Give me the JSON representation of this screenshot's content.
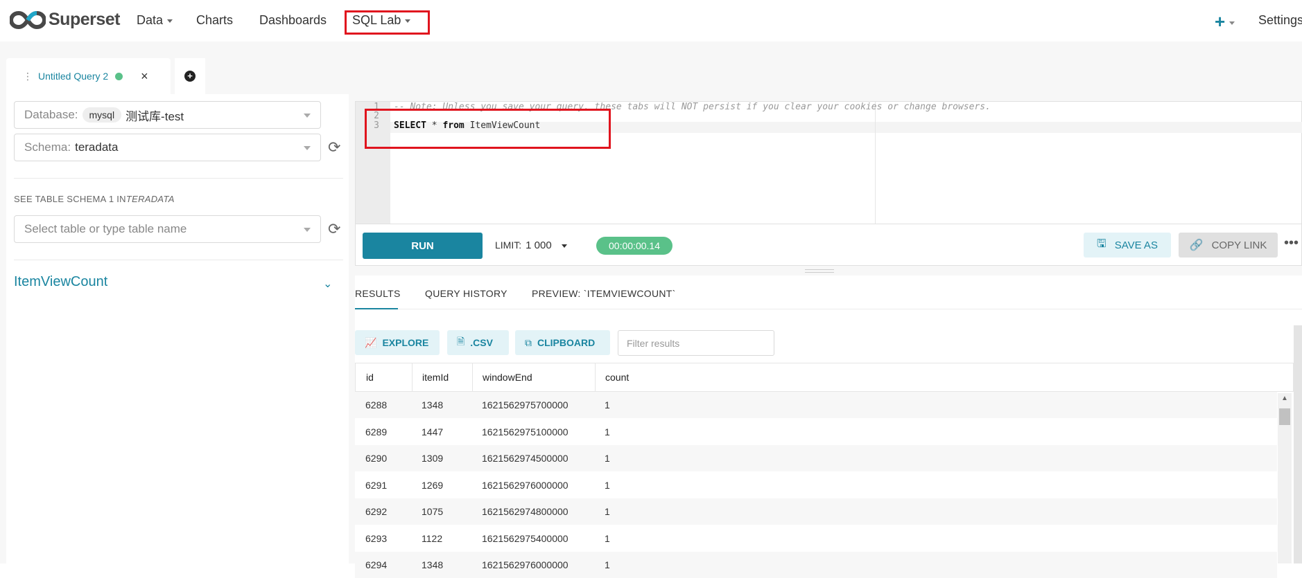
{
  "app": {
    "brand": "Superset",
    "nav": {
      "data": "Data",
      "charts": "Charts",
      "dashboards": "Dashboards",
      "sql_lab": "SQL Lab",
      "settings": "Settings",
      "plus": "+"
    },
    "accent": "#1a85a0"
  },
  "query_tab": {
    "label": "Untitled Query 2",
    "close": "×",
    "add": "+"
  },
  "left_panel": {
    "database_label": "Database:",
    "database_tag": "mysql",
    "database_value": "测试库-test",
    "schema_label": "Schema:",
    "schema_value": "teradata",
    "schema_heading": "SEE TABLE SCHEMA 1 IN",
    "schema_heading_em": "TERADATA",
    "table_select_placeholder": "Select table or type table name",
    "table_name": "ItemViewCount"
  },
  "editor": {
    "line_numbers": [
      "1",
      "2",
      "3"
    ],
    "line1": "-- Note: Unless you save your query, these tabs will NOT persist if you clear your cookies or change browsers.",
    "line3_kw1": "SELECT",
    "line3_star": " * ",
    "line3_kw2": "from",
    "line3_table": " ItemViewCount"
  },
  "controls": {
    "run": "RUN",
    "limit_label": "LIMIT:",
    "limit_value": "1 000",
    "timer": "00:00:00.14",
    "save_as": "SAVE AS",
    "copy_link": "COPY LINK",
    "more": "•••"
  },
  "results": {
    "tabs": [
      "RESULTS",
      "QUERY HISTORY",
      "PREVIEW: `ITEMVIEWCOUNT`"
    ],
    "explore": "EXPLORE",
    "csv": ".CSV",
    "clipboard": "CLIPBOARD",
    "filter_placeholder": "Filter results",
    "columns": [
      "id",
      "itemId",
      "windowEnd",
      "count"
    ],
    "rows": [
      [
        "6288",
        "1348",
        "1621562975700000",
        "1"
      ],
      [
        "6289",
        "1447",
        "1621562975100000",
        "1"
      ],
      [
        "6290",
        "1309",
        "1621562974500000",
        "1"
      ],
      [
        "6291",
        "1269",
        "1621562976000000",
        "1"
      ],
      [
        "6292",
        "1075",
        "1621562974800000",
        "1"
      ],
      [
        "6293",
        "1122",
        "1621562975400000",
        "1"
      ],
      [
        "6294",
        "1348",
        "1621562976000000",
        "1"
      ]
    ]
  }
}
